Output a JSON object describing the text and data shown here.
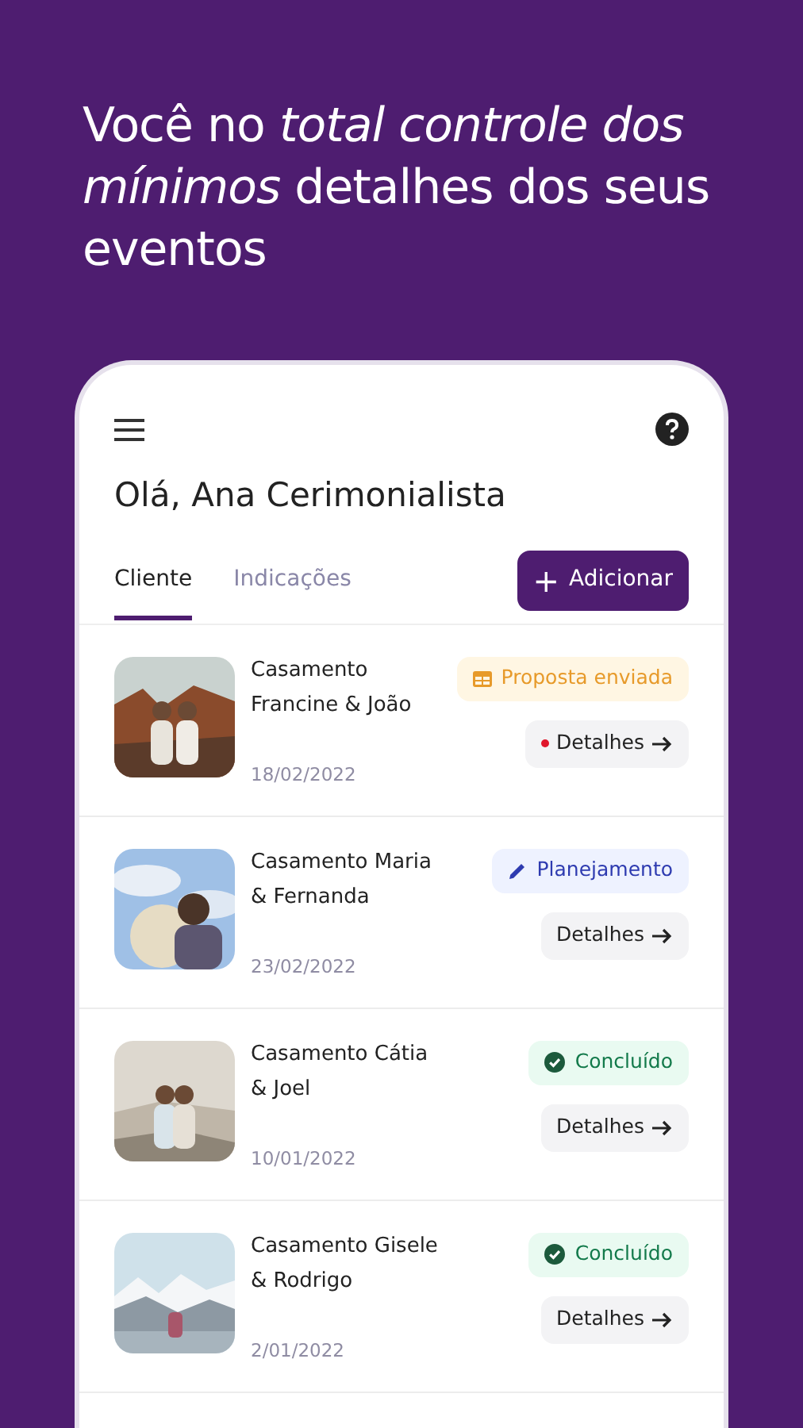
{
  "headline": "Você no *total controle dos mínimos* detalhes dos seus eventos",
  "app": {
    "greeting": "Olá, Ana Cerimonialista",
    "tabs": [
      {
        "label": "Cliente",
        "selected": true
      },
      {
        "label": "Indicações",
        "selected": false
      }
    ],
    "add_button": {
      "icon": "+",
      "label": "Adicionar"
    },
    "events": [
      {
        "title": "Casamento Francine & João",
        "date": "18/02/2022",
        "status": {
          "kind": "proposal",
          "label": "Proposta enviada"
        },
        "details": "Detalhes",
        "unread": true
      },
      {
        "title": "Casamento Maria & Fernanda",
        "date": "23/02/2022",
        "status": {
          "kind": "planning",
          "label": "Planejamento"
        },
        "details": "Detalhes",
        "unread": false
      },
      {
        "title": "Casamento Cátia & Joel",
        "date": "10/01/2022",
        "status": {
          "kind": "done",
          "label": "Concluído"
        },
        "details": "Detalhes",
        "unread": false
      },
      {
        "title": "Casamento Gisele & Rodrigo",
        "date": "2/01/2022",
        "status": {
          "kind": "done",
          "label": "Concluído"
        },
        "details": "Detalhes",
        "unread": false
      }
    ]
  }
}
